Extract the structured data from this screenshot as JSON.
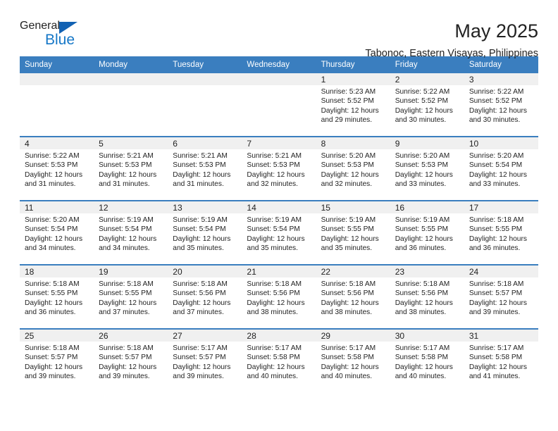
{
  "brand": {
    "name_top": "General",
    "name_bottom": "Blue",
    "triangle_color": "#1262b3",
    "blue_text_color": "#1577c7"
  },
  "header": {
    "title": "May 2025",
    "subtitle": "Tabonoc, Eastern Visayas, Philippines",
    "header_bg_color": "#3a7ebf",
    "daynum_bg_color": "#f0f0f0"
  },
  "weekday_headers": [
    "Sunday",
    "Monday",
    "Tuesday",
    "Wednesday",
    "Thursday",
    "Friday",
    "Saturday"
  ],
  "weeks": [
    [
      {
        "day": "",
        "blank": true,
        "sunrise": "",
        "sunset": "",
        "daylight1": "",
        "daylight2": ""
      },
      {
        "day": "",
        "blank": true,
        "sunrise": "",
        "sunset": "",
        "daylight1": "",
        "daylight2": ""
      },
      {
        "day": "",
        "blank": true,
        "sunrise": "",
        "sunset": "",
        "daylight1": "",
        "daylight2": ""
      },
      {
        "day": "",
        "blank": true,
        "sunrise": "",
        "sunset": "",
        "daylight1": "",
        "daylight2": ""
      },
      {
        "day": "1",
        "blank": false,
        "sunrise": "Sunrise: 5:23 AM",
        "sunset": "Sunset: 5:52 PM",
        "daylight1": "Daylight: 12 hours",
        "daylight2": "and 29 minutes."
      },
      {
        "day": "2",
        "blank": false,
        "sunrise": "Sunrise: 5:22 AM",
        "sunset": "Sunset: 5:52 PM",
        "daylight1": "Daylight: 12 hours",
        "daylight2": "and 30 minutes."
      },
      {
        "day": "3",
        "blank": false,
        "sunrise": "Sunrise: 5:22 AM",
        "sunset": "Sunset: 5:52 PM",
        "daylight1": "Daylight: 12 hours",
        "daylight2": "and 30 minutes."
      }
    ],
    [
      {
        "day": "4",
        "blank": false,
        "sunrise": "Sunrise: 5:22 AM",
        "sunset": "Sunset: 5:53 PM",
        "daylight1": "Daylight: 12 hours",
        "daylight2": "and 31 minutes."
      },
      {
        "day": "5",
        "blank": false,
        "sunrise": "Sunrise: 5:21 AM",
        "sunset": "Sunset: 5:53 PM",
        "daylight1": "Daylight: 12 hours",
        "daylight2": "and 31 minutes."
      },
      {
        "day": "6",
        "blank": false,
        "sunrise": "Sunrise: 5:21 AM",
        "sunset": "Sunset: 5:53 PM",
        "daylight1": "Daylight: 12 hours",
        "daylight2": "and 31 minutes."
      },
      {
        "day": "7",
        "blank": false,
        "sunrise": "Sunrise: 5:21 AM",
        "sunset": "Sunset: 5:53 PM",
        "daylight1": "Daylight: 12 hours",
        "daylight2": "and 32 minutes."
      },
      {
        "day": "8",
        "blank": false,
        "sunrise": "Sunrise: 5:20 AM",
        "sunset": "Sunset: 5:53 PM",
        "daylight1": "Daylight: 12 hours",
        "daylight2": "and 32 minutes."
      },
      {
        "day": "9",
        "blank": false,
        "sunrise": "Sunrise: 5:20 AM",
        "sunset": "Sunset: 5:53 PM",
        "daylight1": "Daylight: 12 hours",
        "daylight2": "and 33 minutes."
      },
      {
        "day": "10",
        "blank": false,
        "sunrise": "Sunrise: 5:20 AM",
        "sunset": "Sunset: 5:54 PM",
        "daylight1": "Daylight: 12 hours",
        "daylight2": "and 33 minutes."
      }
    ],
    [
      {
        "day": "11",
        "blank": false,
        "sunrise": "Sunrise: 5:20 AM",
        "sunset": "Sunset: 5:54 PM",
        "daylight1": "Daylight: 12 hours",
        "daylight2": "and 34 minutes."
      },
      {
        "day": "12",
        "blank": false,
        "sunrise": "Sunrise: 5:19 AM",
        "sunset": "Sunset: 5:54 PM",
        "daylight1": "Daylight: 12 hours",
        "daylight2": "and 34 minutes."
      },
      {
        "day": "13",
        "blank": false,
        "sunrise": "Sunrise: 5:19 AM",
        "sunset": "Sunset: 5:54 PM",
        "daylight1": "Daylight: 12 hours",
        "daylight2": "and 35 minutes."
      },
      {
        "day": "14",
        "blank": false,
        "sunrise": "Sunrise: 5:19 AM",
        "sunset": "Sunset: 5:54 PM",
        "daylight1": "Daylight: 12 hours",
        "daylight2": "and 35 minutes."
      },
      {
        "day": "15",
        "blank": false,
        "sunrise": "Sunrise: 5:19 AM",
        "sunset": "Sunset: 5:55 PM",
        "daylight1": "Daylight: 12 hours",
        "daylight2": "and 35 minutes."
      },
      {
        "day": "16",
        "blank": false,
        "sunrise": "Sunrise: 5:19 AM",
        "sunset": "Sunset: 5:55 PM",
        "daylight1": "Daylight: 12 hours",
        "daylight2": "and 36 minutes."
      },
      {
        "day": "17",
        "blank": false,
        "sunrise": "Sunrise: 5:18 AM",
        "sunset": "Sunset: 5:55 PM",
        "daylight1": "Daylight: 12 hours",
        "daylight2": "and 36 minutes."
      }
    ],
    [
      {
        "day": "18",
        "blank": false,
        "sunrise": "Sunrise: 5:18 AM",
        "sunset": "Sunset: 5:55 PM",
        "daylight1": "Daylight: 12 hours",
        "daylight2": "and 36 minutes."
      },
      {
        "day": "19",
        "blank": false,
        "sunrise": "Sunrise: 5:18 AM",
        "sunset": "Sunset: 5:55 PM",
        "daylight1": "Daylight: 12 hours",
        "daylight2": "and 37 minutes."
      },
      {
        "day": "20",
        "blank": false,
        "sunrise": "Sunrise: 5:18 AM",
        "sunset": "Sunset: 5:56 PM",
        "daylight1": "Daylight: 12 hours",
        "daylight2": "and 37 minutes."
      },
      {
        "day": "21",
        "blank": false,
        "sunrise": "Sunrise: 5:18 AM",
        "sunset": "Sunset: 5:56 PM",
        "daylight1": "Daylight: 12 hours",
        "daylight2": "and 38 minutes."
      },
      {
        "day": "22",
        "blank": false,
        "sunrise": "Sunrise: 5:18 AM",
        "sunset": "Sunset: 5:56 PM",
        "daylight1": "Daylight: 12 hours",
        "daylight2": "and 38 minutes."
      },
      {
        "day": "23",
        "blank": false,
        "sunrise": "Sunrise: 5:18 AM",
        "sunset": "Sunset: 5:56 PM",
        "daylight1": "Daylight: 12 hours",
        "daylight2": "and 38 minutes."
      },
      {
        "day": "24",
        "blank": false,
        "sunrise": "Sunrise: 5:18 AM",
        "sunset": "Sunset: 5:57 PM",
        "daylight1": "Daylight: 12 hours",
        "daylight2": "and 39 minutes."
      }
    ],
    [
      {
        "day": "25",
        "blank": false,
        "sunrise": "Sunrise: 5:18 AM",
        "sunset": "Sunset: 5:57 PM",
        "daylight1": "Daylight: 12 hours",
        "daylight2": "and 39 minutes."
      },
      {
        "day": "26",
        "blank": false,
        "sunrise": "Sunrise: 5:18 AM",
        "sunset": "Sunset: 5:57 PM",
        "daylight1": "Daylight: 12 hours",
        "daylight2": "and 39 minutes."
      },
      {
        "day": "27",
        "blank": false,
        "sunrise": "Sunrise: 5:17 AM",
        "sunset": "Sunset: 5:57 PM",
        "daylight1": "Daylight: 12 hours",
        "daylight2": "and 39 minutes."
      },
      {
        "day": "28",
        "blank": false,
        "sunrise": "Sunrise: 5:17 AM",
        "sunset": "Sunset: 5:58 PM",
        "daylight1": "Daylight: 12 hours",
        "daylight2": "and 40 minutes."
      },
      {
        "day": "29",
        "blank": false,
        "sunrise": "Sunrise: 5:17 AM",
        "sunset": "Sunset: 5:58 PM",
        "daylight1": "Daylight: 12 hours",
        "daylight2": "and 40 minutes."
      },
      {
        "day": "30",
        "blank": false,
        "sunrise": "Sunrise: 5:17 AM",
        "sunset": "Sunset: 5:58 PM",
        "daylight1": "Daylight: 12 hours",
        "daylight2": "and 40 minutes."
      },
      {
        "day": "31",
        "blank": false,
        "sunrise": "Sunrise: 5:17 AM",
        "sunset": "Sunset: 5:58 PM",
        "daylight1": "Daylight: 12 hours",
        "daylight2": "and 41 minutes."
      }
    ]
  ]
}
